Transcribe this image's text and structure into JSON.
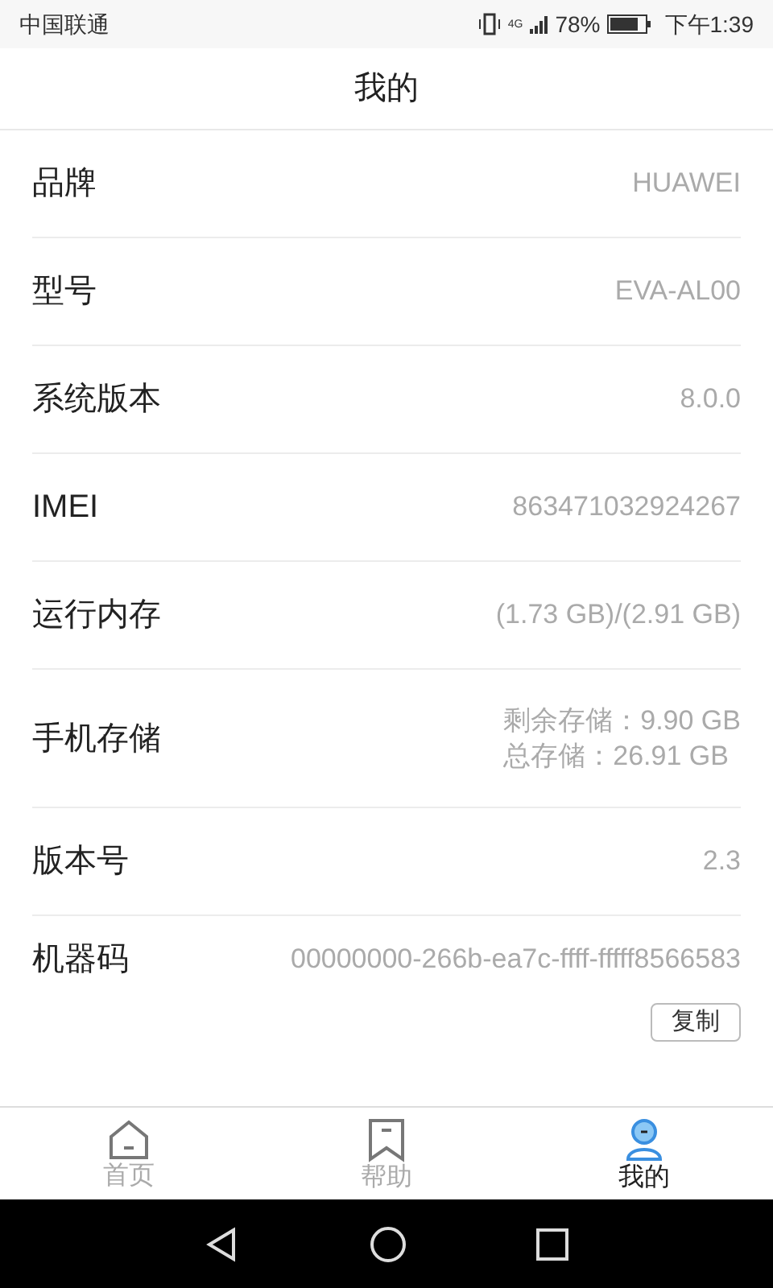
{
  "status_bar": {
    "carrier": "中国联通",
    "network": "4G",
    "battery": "78%",
    "time": "下午1:39"
  },
  "header": {
    "title": "我的"
  },
  "rows": [
    {
      "label": "品牌",
      "values": [
        "HUAWEI"
      ]
    },
    {
      "label": "型号",
      "values": [
        "EVA-AL00"
      ]
    },
    {
      "label": "系统版本",
      "values": [
        "8.0.0"
      ]
    },
    {
      "label": "IMEI",
      "values": [
        "863471032924267"
      ]
    },
    {
      "label": "运行内存",
      "values": [
        "(1.73 GB)/(2.91 GB)"
      ]
    },
    {
      "label": "手机存储",
      "values": [
        "剩余存储：9.90 GB",
        "总存储：26.91 GB"
      ]
    },
    {
      "label": "版本号",
      "values": [
        "2.3"
      ]
    },
    {
      "label": "机器码",
      "values": [
        "00000000-266b-ea7c-ffff-fffff8566583"
      ],
      "action": "复制"
    }
  ],
  "tabs": [
    {
      "label": "首页",
      "kind": "home",
      "selected": false
    },
    {
      "label": "帮助",
      "kind": "help",
      "selected": false
    },
    {
      "label": "我的",
      "kind": "me",
      "selected": true
    }
  ]
}
